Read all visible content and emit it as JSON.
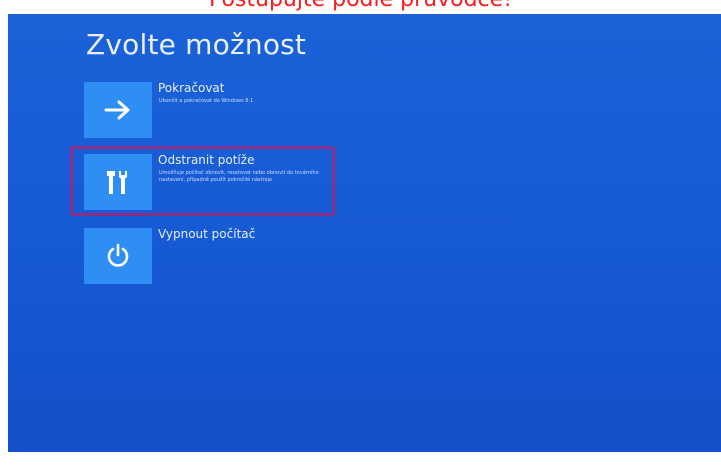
{
  "caption": "Postupujte podle průvodce!",
  "screen": {
    "title": "Zvolte možnost"
  },
  "options": [
    {
      "label": "Pokračovat",
      "description": "Ukončit a pokračovat do Windows 8.1",
      "icon": "arrow-right-icon"
    },
    {
      "label": "Odstranit potíže",
      "description": "Umožňuje počítač obnovit, resetovat nebo obnovit do továrního nastavení, případně použít pokročilé nástroje",
      "icon": "tools-icon",
      "highlighted": true
    },
    {
      "label": "Vypnout počítač",
      "description": "",
      "icon": "power-icon"
    }
  ],
  "colors": {
    "background": "#1659d4",
    "tile": "#2f8ef4",
    "highlight_border": "#8c2f86",
    "caption": "#ff1a1a"
  }
}
